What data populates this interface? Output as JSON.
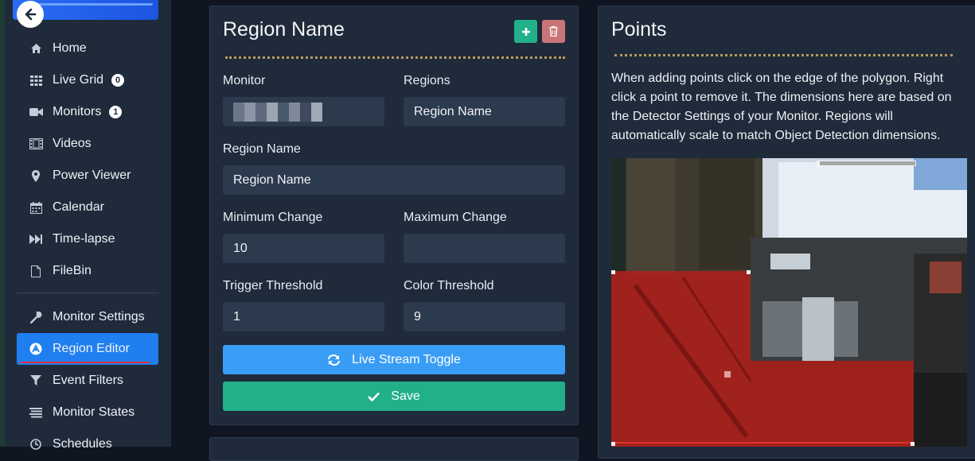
{
  "sidebar": {
    "items": [
      {
        "label": "Home",
        "icon": "home-icon"
      },
      {
        "label": "Live Grid",
        "icon": "grid-icon",
        "badge": "0"
      },
      {
        "label": "Monitors",
        "icon": "video-camera-icon",
        "badge": "1"
      },
      {
        "label": "Videos",
        "icon": "film-icon"
      },
      {
        "label": "Power Viewer",
        "icon": "map-pin-icon"
      },
      {
        "label": "Calendar",
        "icon": "calendar-icon"
      },
      {
        "label": "Time-lapse",
        "icon": "fast-forward-icon"
      },
      {
        "label": "FileBin",
        "icon": "file-icon"
      },
      {
        "label": "Monitor Settings",
        "icon": "wrench-icon"
      },
      {
        "label": "Region Editor",
        "icon": "region-editor-icon",
        "active": true
      },
      {
        "label": "Event Filters",
        "icon": "filter-icon"
      },
      {
        "label": "Monitor States",
        "icon": "list-icon"
      },
      {
        "label": "Schedules",
        "icon": "clock-icon"
      }
    ]
  },
  "region_panel": {
    "title": "Region Name",
    "monitor_label": "Monitor",
    "regions_label": "Regions",
    "regions_value": "Region Name",
    "region_name_label": "Region Name",
    "region_name_value": "Region Name",
    "min_change_label": "Minimum Change",
    "min_change_value": "10",
    "max_change_label": "Maximum Change",
    "max_change_value": "",
    "trigger_label": "Trigger Threshold",
    "trigger_value": "1",
    "color_label": "Color Threshold",
    "color_value": "9",
    "live_stream_label": "Live Stream Toggle",
    "save_label": "Save"
  },
  "points_panel": {
    "title": "Points",
    "help_text": "When adding points click on the edge of the polygon. Right click a point to remove it. The dimensions here are based on the Detector Settings of your Monitor. Regions will automatically scale to match Object Detection dimensions."
  },
  "colors": {
    "accent_blue": "#1f7ff0",
    "stream_blue": "#3a9df5",
    "save_green": "#22b08a",
    "delete_red": "#c97476",
    "region_overlay": "#b0211c"
  }
}
